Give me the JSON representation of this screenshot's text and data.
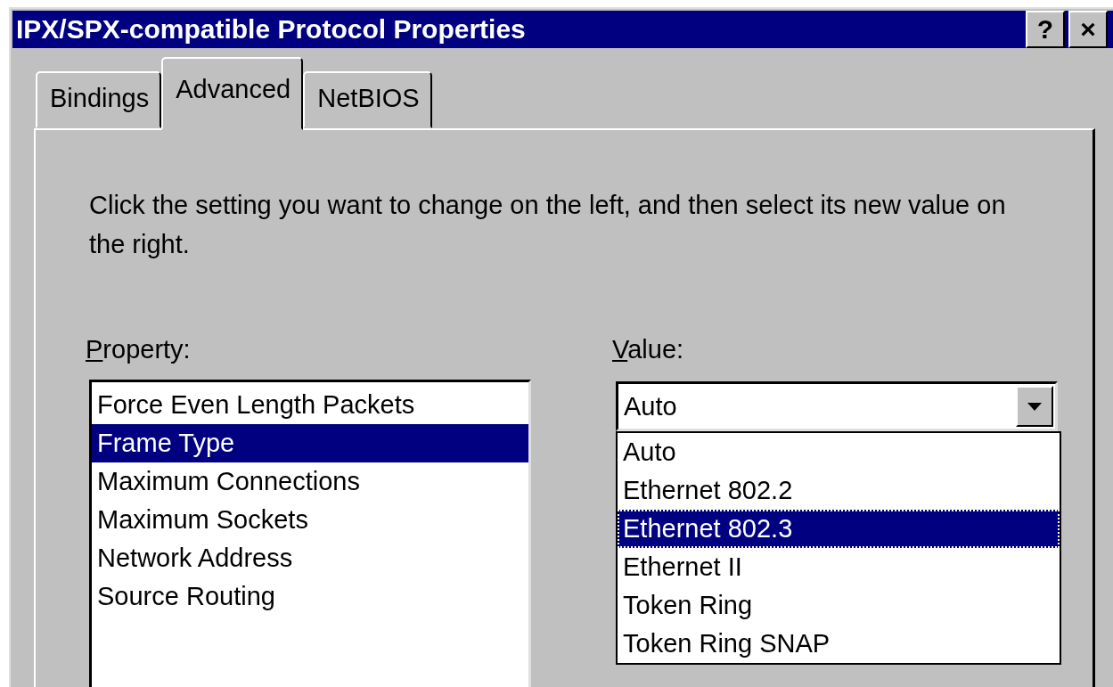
{
  "window": {
    "title": "IPX/SPX-compatible Protocol Properties",
    "help_button": "?",
    "close_button": "×"
  },
  "tabs": [
    {
      "label": "Bindings",
      "selected": false
    },
    {
      "label": "Advanced",
      "selected": true
    },
    {
      "label": "NetBIOS",
      "selected": false
    }
  ],
  "instructions": "Click the setting you want to change on the left, and then select its new value on the right.",
  "property": {
    "label": "Property:",
    "mnemonic_first_letter": true,
    "items": [
      {
        "label": "Force Even Length Packets",
        "selected": false
      },
      {
        "label": "Frame Type",
        "selected": true
      },
      {
        "label": "Maximum Connections",
        "selected": false
      },
      {
        "label": "Maximum Sockets",
        "selected": false
      },
      {
        "label": "Network Address",
        "selected": false
      },
      {
        "label": "Source Routing",
        "selected": false
      }
    ]
  },
  "value": {
    "label": "Value:",
    "mnemonic_first_letter": true,
    "current": "Auto",
    "expanded": true,
    "options": [
      {
        "label": "Auto",
        "highlighted": false
      },
      {
        "label": "Ethernet 802.2",
        "highlighted": false
      },
      {
        "label": "Ethernet 802.3",
        "highlighted": true
      },
      {
        "label": "Ethernet II",
        "highlighted": false
      },
      {
        "label": "Token Ring",
        "highlighted": false
      },
      {
        "label": "Token Ring SNAP",
        "highlighted": false
      }
    ]
  }
}
